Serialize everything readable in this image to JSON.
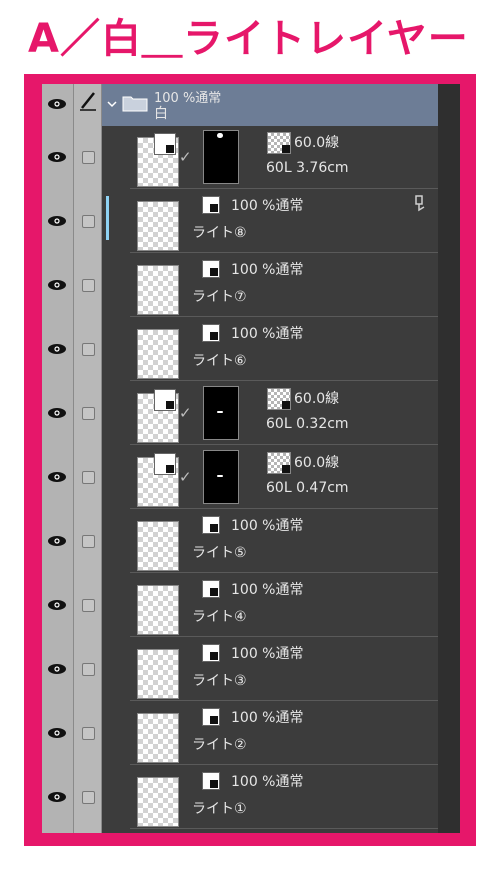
{
  "title": "A／白＿ライトレイヤー",
  "folder": {
    "opacity_mode": "100 %通常",
    "name": "白"
  },
  "layers": [
    {
      "kind": "tone",
      "tone": "60.0線",
      "detail": "60L 3.76cm",
      "mask_dot": "top"
    },
    {
      "kind": "raster",
      "mode": "100 %通常",
      "name": "ライト⑧",
      "selected": true,
      "extra_icon": true
    },
    {
      "kind": "raster",
      "mode": "100 %通常",
      "name": "ライト⑦"
    },
    {
      "kind": "raster",
      "mode": "100 %通常",
      "name": "ライト⑥"
    },
    {
      "kind": "tone",
      "tone": "60.0線",
      "detail": "60L 0.32cm",
      "mask_dot": "center"
    },
    {
      "kind": "tone",
      "tone": "60.0線",
      "detail": "60L 0.47cm",
      "mask_dot": "center"
    },
    {
      "kind": "raster",
      "mode": "100 %通常",
      "name": "ライト⑤"
    },
    {
      "kind": "raster",
      "mode": "100 %通常",
      "name": "ライト④"
    },
    {
      "kind": "raster",
      "mode": "100 %通常",
      "name": "ライト③"
    },
    {
      "kind": "raster",
      "mode": "100 %通常",
      "name": "ライト②"
    },
    {
      "kind": "raster",
      "mode": "100 %通常",
      "name": "ライト①"
    }
  ],
  "icons": {
    "visibility": "eye-icon",
    "edit": "pencil-icon",
    "expand": "chevron-down-icon",
    "folder": "folder-icon"
  },
  "colors": {
    "accent": "#e6176a",
    "panel": "#3c3c3c",
    "folder_row": "#6d7d96"
  }
}
